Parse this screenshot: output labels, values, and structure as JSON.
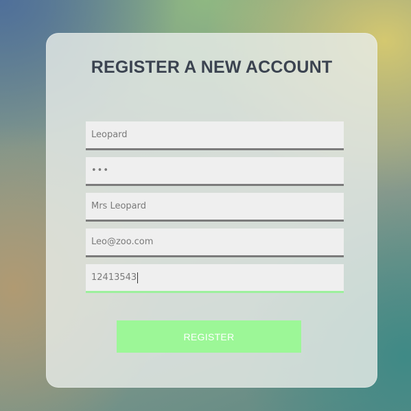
{
  "form": {
    "title": "REGISTER A NEW ACCOUNT",
    "fields": [
      {
        "name": "username",
        "value": "Leopard",
        "type": "text"
      },
      {
        "name": "password",
        "value": "•••",
        "type": "password"
      },
      {
        "name": "full_name",
        "value": "Mrs Leopard",
        "type": "text"
      },
      {
        "name": "email",
        "value": "Leo@zoo.com",
        "type": "text"
      },
      {
        "name": "phone",
        "value": "12413543",
        "type": "text",
        "focused": true
      }
    ],
    "register_label": "REGISTER"
  },
  "colors": {
    "title": "#3b4350",
    "field_bg": "#efefef",
    "field_border": "#7b7b7b",
    "focused_border": "#9cf09c",
    "button_bg": "#9cf797",
    "button_text": "#ffffff"
  }
}
